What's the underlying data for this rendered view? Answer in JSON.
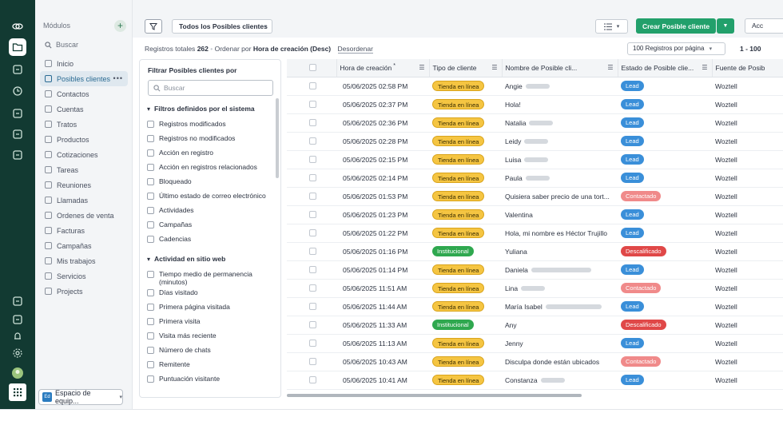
{
  "rail": {
    "icons": [
      "app-logo-icon",
      "folder-icon",
      "chart-icon",
      "clock-icon",
      "ticket-icon",
      "store-icon",
      "analytics-icon",
      "add-note-icon",
      "window-icon",
      "bell-icon",
      "settings-icon",
      "avatar",
      "apps-grid-icon"
    ]
  },
  "modules": {
    "title": "Módulos",
    "search_placeholder": "Buscar",
    "items": [
      {
        "label": "Inicio"
      },
      {
        "label": "Posibles clientes"
      },
      {
        "label": "Contactos"
      },
      {
        "label": "Cuentas"
      },
      {
        "label": "Tratos"
      },
      {
        "label": "Productos"
      },
      {
        "label": "Cotizaciones"
      },
      {
        "label": "Tareas"
      },
      {
        "label": "Reuniones"
      },
      {
        "label": "Llamadas"
      },
      {
        "label": "Ordenes de venta"
      },
      {
        "label": "Facturas"
      },
      {
        "label": "Campañas"
      },
      {
        "label": "Mis trabajos"
      },
      {
        "label": "Servicios"
      },
      {
        "label": "Projects"
      }
    ],
    "workspace_label": "Espacio de equip..."
  },
  "toolbar": {
    "view_label": "Todos los Posibles clientes",
    "create_label": "Crear Posible cliente",
    "actions_label": "Acc"
  },
  "stats": {
    "total_label": "Registros totales",
    "total_value": "262",
    "sort_prefix": "Ordenar por",
    "sort_field": "Hora de creación (Desc)",
    "unsort_label": "Desordenar",
    "per_page": "100 Registros por página",
    "range": "1 - 100"
  },
  "filter_panel": {
    "title": "Filtrar Posibles clientes por",
    "search_placeholder": "Buscar",
    "sections": [
      {
        "title": "Filtros definidos por el sistema",
        "items": [
          "Registros modificados",
          "Registros no modificados",
          "Acción en registro",
          "Acción en registros relacionados",
          "Bloqueado",
          "Último estado de correo electrónico",
          "Actividades",
          "Campañas",
          "Cadencias"
        ]
      },
      {
        "title": "Actividad en sitio web",
        "items": [
          "Tiempo medio de permanencia (minutos)",
          "Días visitado",
          "Primera página visitada",
          "Primera visita",
          "Visita más reciente",
          "Número de chats",
          "Remitente",
          "Puntuación visitante"
        ]
      }
    ]
  },
  "table": {
    "columns": [
      "Hora de creación",
      "Tipo de cliente",
      "Nombre de Posible cli...",
      "Estado de Posible clie...",
      "Fuente de Posib"
    ],
    "rows": [
      {
        "time": "05/06/2025 02:58 PM",
        "type": "Tienda en línea",
        "name": "Angie",
        "status": "Lead",
        "source": "Woztell"
      },
      {
        "time": "05/06/2025 02:37 PM",
        "type": "Tienda en línea",
        "name": "Hola!",
        "status": "Lead",
        "source": "Woztell"
      },
      {
        "time": "05/06/2025 02:36 PM",
        "type": "Tienda en línea",
        "name": "Natalia",
        "status": "Lead",
        "source": "Woztell"
      },
      {
        "time": "05/06/2025 02:28 PM",
        "type": "Tienda en línea",
        "name": "Leidy",
        "status": "Lead",
        "source": "Woztell"
      },
      {
        "time": "05/06/2025 02:15 PM",
        "type": "Tienda en línea",
        "name": "Luisa",
        "status": "Lead",
        "source": "Woztell"
      },
      {
        "time": "05/06/2025 02:14 PM",
        "type": "Tienda en línea",
        "name": "Paula",
        "status": "Lead",
        "source": "Woztell"
      },
      {
        "time": "05/06/2025 01:53 PM",
        "type": "Tienda en línea",
        "name": "Quisiera saber precio de una tort...",
        "status": "Contactado",
        "source": "Woztell"
      },
      {
        "time": "05/06/2025 01:23 PM",
        "type": "Tienda en línea",
        "name": "Valentina",
        "status": "Lead",
        "source": "Woztell"
      },
      {
        "time": "05/06/2025 01:22 PM",
        "type": "Tienda en línea",
        "name": "Hola, mi nombre es Héctor Trujillo",
        "status": "Lead",
        "source": "Woztell"
      },
      {
        "time": "05/06/2025 01:16 PM",
        "type": "Institucional",
        "name": "Yuliana",
        "status": "Descalificado",
        "source": "Woztell"
      },
      {
        "time": "05/06/2025 01:14 PM",
        "type": "Tienda en línea",
        "name": "Daniela",
        "status": "Lead",
        "source": "Woztell"
      },
      {
        "time": "05/06/2025 11:51 AM",
        "type": "Tienda en línea",
        "name": "Lina",
        "status": "Contactado",
        "source": "Woztell"
      },
      {
        "time": "05/06/2025 11:44 AM",
        "type": "Tienda en línea",
        "name": "María Isabel",
        "status": "Lead",
        "source": "Woztell"
      },
      {
        "time": "05/06/2025 11:33 AM",
        "type": "Institucional",
        "name": "Any",
        "status": "Descalificado",
        "source": "Woztell"
      },
      {
        "time": "05/06/2025 11:13 AM",
        "type": "Tienda en línea",
        "name": "Jenny",
        "status": "Lead",
        "source": "Woztell"
      },
      {
        "time": "05/06/2025 10:43 AM",
        "type": "Tienda en línea",
        "name": "Disculpa donde están ubicados",
        "status": "Contactado",
        "source": "Woztell"
      },
      {
        "time": "05/06/2025 10:41 AM",
        "type": "Tienda en línea",
        "name": "Constanza",
        "status": "Lead",
        "source": "Woztell"
      }
    ]
  },
  "colors": {
    "rail_bg": "#123a32",
    "create_button": "#22a06b",
    "pill_tienda": "#f5c542",
    "pill_institucional": "#2fa84f",
    "pill_lead": "#3a8fd9",
    "pill_contactado": "#f08a8a",
    "pill_descalificado": "#e04848"
  }
}
